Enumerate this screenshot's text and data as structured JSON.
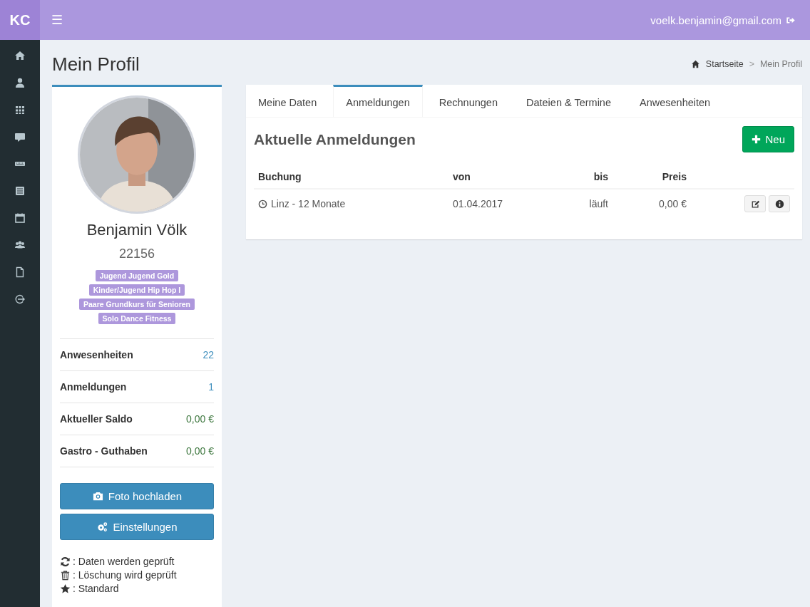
{
  "header": {
    "logo": "KC",
    "menu_icon": "☰",
    "user_email": "voelk.benjamin@gmail.com"
  },
  "page": {
    "title": "Mein Profil",
    "breadcrumb": [
      {
        "label": "Startseite",
        "kind": "home"
      },
      {
        "label": "Mein Profil",
        "kind": "current"
      }
    ],
    "separator": ">"
  },
  "profile": {
    "photo": {
      "kind": "picture"
    },
    "name": "Benjamin Völk",
    "member_number": "22156",
    "tags": [
      "Jugend Jugend Gold",
      "Kinder/Jugend Hip Hop I",
      "Paare Grundkurs für Senioren",
      "Solo Dance Fitness"
    ],
    "stats": [
      {
        "label": "Anwesenheiten",
        "value": "22",
        "kind": "count"
      },
      {
        "label": "Anmeldungen",
        "value": "1",
        "kind": "count"
      },
      {
        "label": "Aktueller Saldo",
        "value": "0,00 €",
        "kind": "money"
      },
      {
        "label": "Gastro - Guthaben",
        "value": "0,00 €",
        "kind": "money"
      }
    ],
    "buttons": [
      {
        "label": "Foto hochladen",
        "kind": "upload"
      },
      {
        "label": "Einstellungen",
        "kind": "settings"
      }
    ],
    "legend": [
      {
        "kind": "refresh",
        "text": ": Daten werden geprüft"
      },
      {
        "kind": "trash",
        "text": ": Löschung wird geprüft"
      },
      {
        "kind": "star",
        "text": ": Standard"
      }
    ]
  },
  "tabs": [
    {
      "label": "Meine Daten",
      "selected": false
    },
    {
      "label": "Anmeldungen",
      "selected": true
    },
    {
      "label": "Rechnungen",
      "selected": false
    },
    {
      "label": "Dateien & Termine",
      "selected": false
    },
    {
      "label": "Anwesenheiten",
      "selected": false
    }
  ],
  "panel": {
    "title": "Aktuelle Anmeldungen",
    "new_button": "Neu",
    "table": {
      "columns": [
        "Buchung",
        "von",
        "bis",
        "Preis"
      ],
      "rows": [
        {
          "buchung": "Linz - 12 Monate",
          "von": "01.04.2017",
          "bis": "läuft",
          "preis": "0,00 €"
        }
      ]
    }
  }
}
